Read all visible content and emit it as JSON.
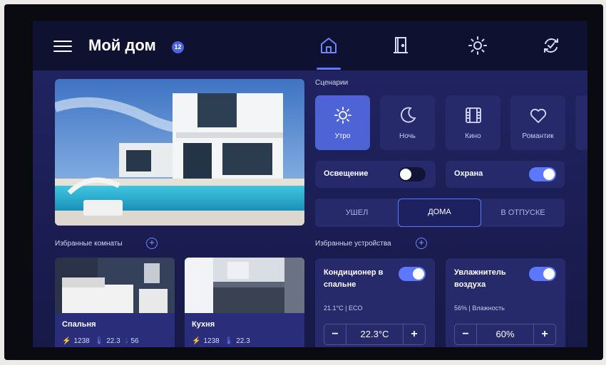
{
  "header": {
    "title": "Мой дом",
    "badge": "12",
    "nav": [
      {
        "icon": "home-icon",
        "active": true
      },
      {
        "icon": "door-icon",
        "active": false
      },
      {
        "icon": "sun-icon",
        "active": false
      },
      {
        "icon": "sync-icon",
        "active": false
      }
    ]
  },
  "scenarios": {
    "label": "Сценарии",
    "items": [
      {
        "label": "Утро",
        "icon": "sun-icon",
        "active": true
      },
      {
        "label": "Ночь",
        "icon": "moon-icon",
        "active": false
      },
      {
        "label": "Кино",
        "icon": "film-icon",
        "active": false
      },
      {
        "label": "Романтик",
        "icon": "heart-icon",
        "active": false
      }
    ]
  },
  "toggles": [
    {
      "label": "Освещение",
      "on": false
    },
    {
      "label": "Охрана",
      "on": true
    }
  ],
  "mode": {
    "options": [
      "УШЕЛ",
      "ДОМА",
      "В ОТПУСКЕ"
    ],
    "selected": "ДОМА"
  },
  "favorite_rooms": {
    "label": "Избранные комнаты",
    "rooms": [
      {
        "name": "Спальня",
        "stat1": "1238",
        "stat2": "22.3",
        "stat3": "56"
      },
      {
        "name": "Кухня",
        "stat1": "1238",
        "stat2": "22.3"
      }
    ]
  },
  "favorite_devices": {
    "label": "Избранные устройства",
    "devices": [
      {
        "name": "Кондиционер в спальне",
        "on": true,
        "status": "21.1°C | ECO",
        "value": "22.3°C",
        "minus": "−",
        "plus": "+"
      },
      {
        "name": "Увлажнитель воздуха",
        "on": true,
        "status": "56% | Влажность",
        "value": "60%",
        "minus": "−",
        "plus": "+"
      }
    ]
  },
  "colors": {
    "accent": "#5b78ff",
    "card": "#262a6b",
    "active_scenario": "#4d63d6",
    "topbar": "#0f1130"
  }
}
